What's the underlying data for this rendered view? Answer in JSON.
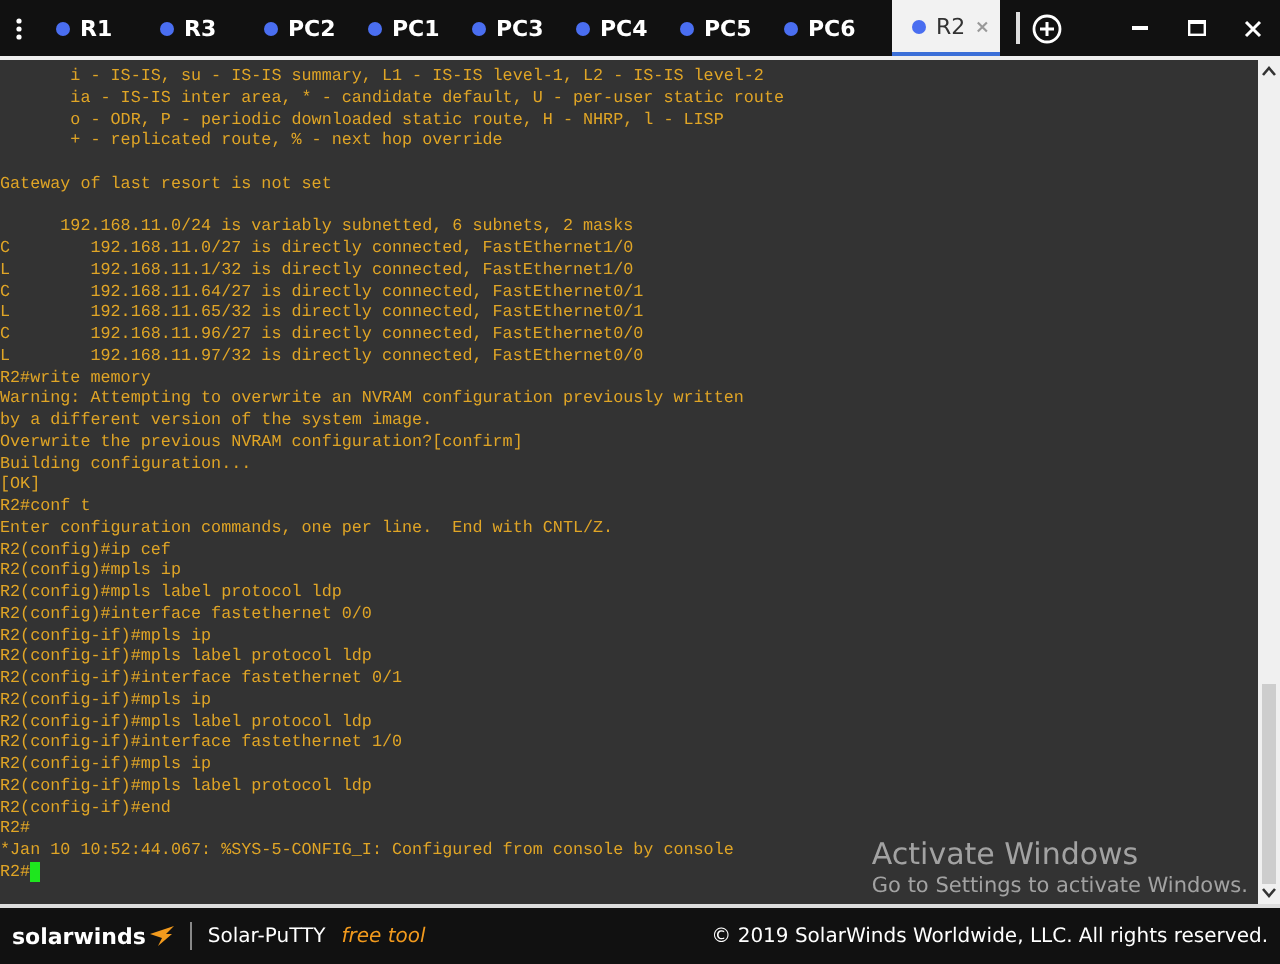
{
  "tabs": [
    {
      "label": "R1",
      "selected": false
    },
    {
      "label": "R3",
      "selected": false
    },
    {
      "label": "PC2",
      "selected": false
    },
    {
      "label": "PC1",
      "selected": false
    },
    {
      "label": "PC3",
      "selected": false
    },
    {
      "label": "PC4",
      "selected": false
    },
    {
      "label": "PC5",
      "selected": false
    },
    {
      "label": "PC6",
      "selected": false
    },
    {
      "label": "R2",
      "selected": true
    }
  ],
  "terminal": {
    "blocks": [
      [
        "       i - IS-IS, su - IS-IS summary, L1 - IS-IS level-1, L2 - IS-IS level-2",
        "       ia - IS-IS inter area, * - candidate default, U - per-user static route",
        "       o - ODR, P - periodic downloaded static route, H - NHRP, l - LISP",
        "       + - replicated route, % - next hop override"
      ],
      [
        "Gateway of last resort is not set"
      ],
      [
        "      192.168.11.0/24 is variably subnetted, 6 subnets, 2 masks",
        "C        192.168.11.0/27 is directly connected, FastEthernet1/0",
        "L        192.168.11.1/32 is directly connected, FastEthernet1/0",
        "C        192.168.11.64/27 is directly connected, FastEthernet0/1",
        "L        192.168.11.65/32 is directly connected, FastEthernet0/1",
        "C        192.168.11.96/27 is directly connected, FastEthernet0/0",
        "L        192.168.11.97/32 is directly connected, FastEthernet0/0",
        "R2#write memory",
        "Warning: Attempting to overwrite an NVRAM configuration previously written",
        "by a different version of the system image.",
        "Overwrite the previous NVRAM configuration?[confirm]",
        "Building configuration...",
        "[OK]",
        "R2#conf t",
        "Enter configuration commands, one per line.  End with CNTL/Z.",
        "R2(config)#ip cef",
        "R2(config)#mpls ip",
        "R2(config)#mpls label protocol ldp",
        "R2(config)#interface fastethernet 0/0",
        "R2(config-if)#mpls ip",
        "R2(config-if)#mpls label protocol ldp",
        "R2(config-if)#interface fastethernet 0/1",
        "R2(config-if)#mpls ip",
        "R2(config-if)#mpls label protocol ldp",
        "R2(config-if)#interface fastethernet 1/0",
        "R2(config-if)#mpls ip",
        "R2(config-if)#mpls label protocol ldp",
        "R2(config-if)#end",
        "R2#",
        "*Jan 10 10:52:44.067: %SYS-5-CONFIG_I: Configured from console by console"
      ]
    ],
    "prompt": "R2#"
  },
  "footer": {
    "brand": "solarwinds",
    "product": "Solar-PuTTY",
    "tagline": "free tool",
    "copyright": "© 2019 SolarWinds Worldwide, LLC. All rights reserved."
  },
  "activation_notice": {
    "title": "Activate Windows",
    "message": "Go to Settings to activate Windows."
  }
}
